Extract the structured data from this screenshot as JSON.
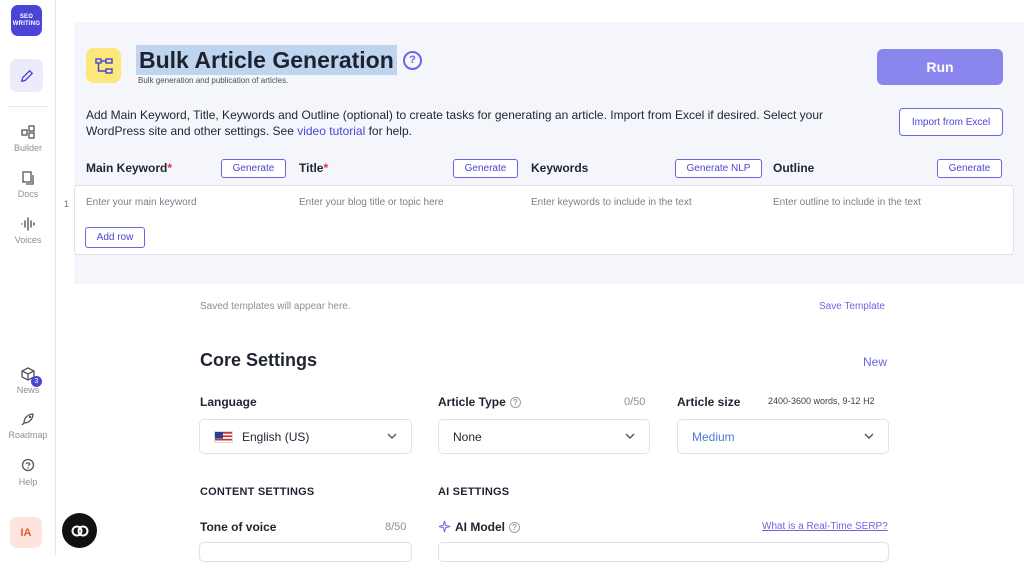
{
  "sidebar": {
    "logo_lines": [
      "SEO",
      "WRITING"
    ],
    "items": [
      {
        "label": "Builder",
        "icon": "builder-icon"
      },
      {
        "label": "Docs",
        "icon": "docs-icon"
      },
      {
        "label": "Voices",
        "icon": "voices-icon"
      },
      {
        "label": "News",
        "icon": "news-icon",
        "badge": "3"
      },
      {
        "label": "Roadmap",
        "icon": "rocket-icon"
      },
      {
        "label": "Help",
        "icon": "help-chat-icon"
      }
    ],
    "avatar_initials": "IA"
  },
  "header": {
    "title": "Bulk Article Generation",
    "subtitle": "Bulk generation and publication of articles.",
    "run_label": "Run",
    "help_symbol": "?"
  },
  "description": {
    "text_before": "Add Main Keyword, Title, Keywords and Outline (optional) to create tasks for generating an article. Import from Excel if desired. Select your WordPress site and other settings. See ",
    "link_text": "video tutorial",
    "text_after": " for help."
  },
  "import_label": "Import from Excel",
  "columns": [
    {
      "label": "Main Keyword",
      "required": "*",
      "button": "Generate",
      "placeholder": "Enter your main keyword"
    },
    {
      "label": "Title",
      "required": "*",
      "button": "Generate",
      "placeholder": "Enter your blog title or topic here"
    },
    {
      "label": "Keywords",
      "required": "",
      "button": "Generate NLP",
      "placeholder": "Enter keywords to include in the text"
    },
    {
      "label": "Outline",
      "required": "",
      "button": "Generate",
      "placeholder": "Enter outline to include in the text"
    }
  ],
  "row_number": "1",
  "add_row_label": "Add row",
  "templates": {
    "empty_text": "Saved templates will appear here.",
    "save_label": "Save Template"
  },
  "core_settings": {
    "title": "Core Settings",
    "new_label": "New",
    "language": {
      "label": "Language",
      "value": "English (US)"
    },
    "article_type": {
      "label": "Article Type",
      "counter": "0/50",
      "value": "None"
    },
    "article_size": {
      "label": "Article size",
      "hint": "2400-3600 words, 9-12 H2",
      "value": "Medium"
    }
  },
  "content_settings": {
    "title": "CONTENT SETTINGS",
    "tone": {
      "label": "Tone of voice",
      "counter": "8/50"
    }
  },
  "ai_settings": {
    "title": "AI SETTINGS",
    "model_label": "AI Model",
    "serp_link": "What is a Real-Time SERP?"
  },
  "colors": {
    "accent": "#4b45d6",
    "run_button": "#8a86ee",
    "panel_bg": "#f5f6fb",
    "required": "#e0343c"
  }
}
